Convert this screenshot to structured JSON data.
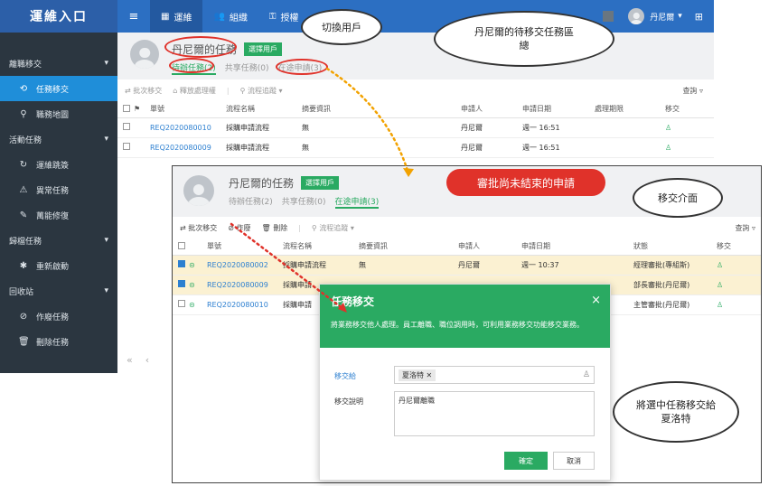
{
  "sidebar": {
    "brand": "運維入口",
    "groups": [
      {
        "label": "離職移交",
        "items": [
          "任務移交",
          "職務地圖"
        ]
      },
      {
        "label": "活動任務",
        "items": [
          "運維跳簽",
          "異常任務",
          "萬能修復"
        ]
      },
      {
        "label": "歸檔任務",
        "items": [
          "重新啟動"
        ]
      },
      {
        "label": "回收站",
        "items": [
          "作廢任務",
          "刪除任務"
        ]
      }
    ]
  },
  "topbar": {
    "tabs": [
      "運維",
      "組織",
      "授權"
    ],
    "user": "丹尼爾"
  },
  "back": {
    "title": "丹尼爾的任務",
    "select_user": "選擇用戶",
    "tabs": [
      "待辦任務(2)",
      "共享任務(0)",
      "在途申請(3)"
    ],
    "toolbar": [
      "批次移交",
      "釋放處理權",
      "流程追蹤"
    ],
    "search": "查詢",
    "columns": [
      "單號",
      "流程名稱",
      "摘要資訊",
      "申請人",
      "申請日期",
      "處理期限",
      "移交"
    ],
    "rows": [
      {
        "no": "REQ2020080010",
        "flow": "採購申請流程",
        "summary": "無",
        "applicant": "丹尼爾",
        "date": "週一 16:51"
      },
      {
        "no": "REQ2020080009",
        "flow": "採購申請流程",
        "summary": "無",
        "applicant": "丹尼爾",
        "date": "週一 16:51"
      }
    ],
    "pager": [
      "«",
      "‹"
    ]
  },
  "front": {
    "title": "丹尼爾的任務",
    "select_user": "選擇用戶",
    "tabs": [
      "待辦任務(2)",
      "共享任務(0)",
      "在途申請(3)"
    ],
    "toolbar": [
      "批次移交",
      "作廢",
      "刪除",
      "流程追蹤"
    ],
    "search": "查詢",
    "columns": [
      "單號",
      "流程名稱",
      "摘要資訊",
      "申請人",
      "申請日期",
      "狀態",
      "移交"
    ],
    "rows": [
      {
        "no": "REQ2020080002",
        "flow": "採購申請流程",
        "summary": "無",
        "applicant": "丹尼爾",
        "date": "週一 10:37",
        "status": "經理審批(專組斯)",
        "checked": true
      },
      {
        "no": "REQ2020080009",
        "flow": "採購申請",
        "summary": "",
        "applicant": "",
        "date": "",
        "status": "部長審批(丹尼爾)",
        "checked": true
      },
      {
        "no": "REQ2020080010",
        "flow": "採購申請",
        "summary": "",
        "applicant": "",
        "date": "",
        "status": "主管審批(丹尼爾)",
        "checked": false
      }
    ]
  },
  "dialog": {
    "title": "任務移交",
    "desc": "將業務移交他人處理。員工離職、職位調用時，可利用業務移交功能移交業務。",
    "to_label": "移交給",
    "to_value": "夏洛特",
    "note_label": "移交說明",
    "note_value": "丹尼爾離職",
    "ok": "確定",
    "cancel": "取消"
  },
  "callouts": {
    "switch_user": "切換用戶",
    "pending_area": "丹尼爾的待移交任務區總",
    "unfinished": "審批尚未結束的申請",
    "handover_ui": "移交介面",
    "assign": "將選中任務移交給夏洛特"
  },
  "colors": {
    "green": "#2aaa62",
    "blue": "#2c6fc2",
    "sidebar": "#2b3640",
    "accent_red": "#e0322a",
    "dotted": "#f2a200"
  }
}
